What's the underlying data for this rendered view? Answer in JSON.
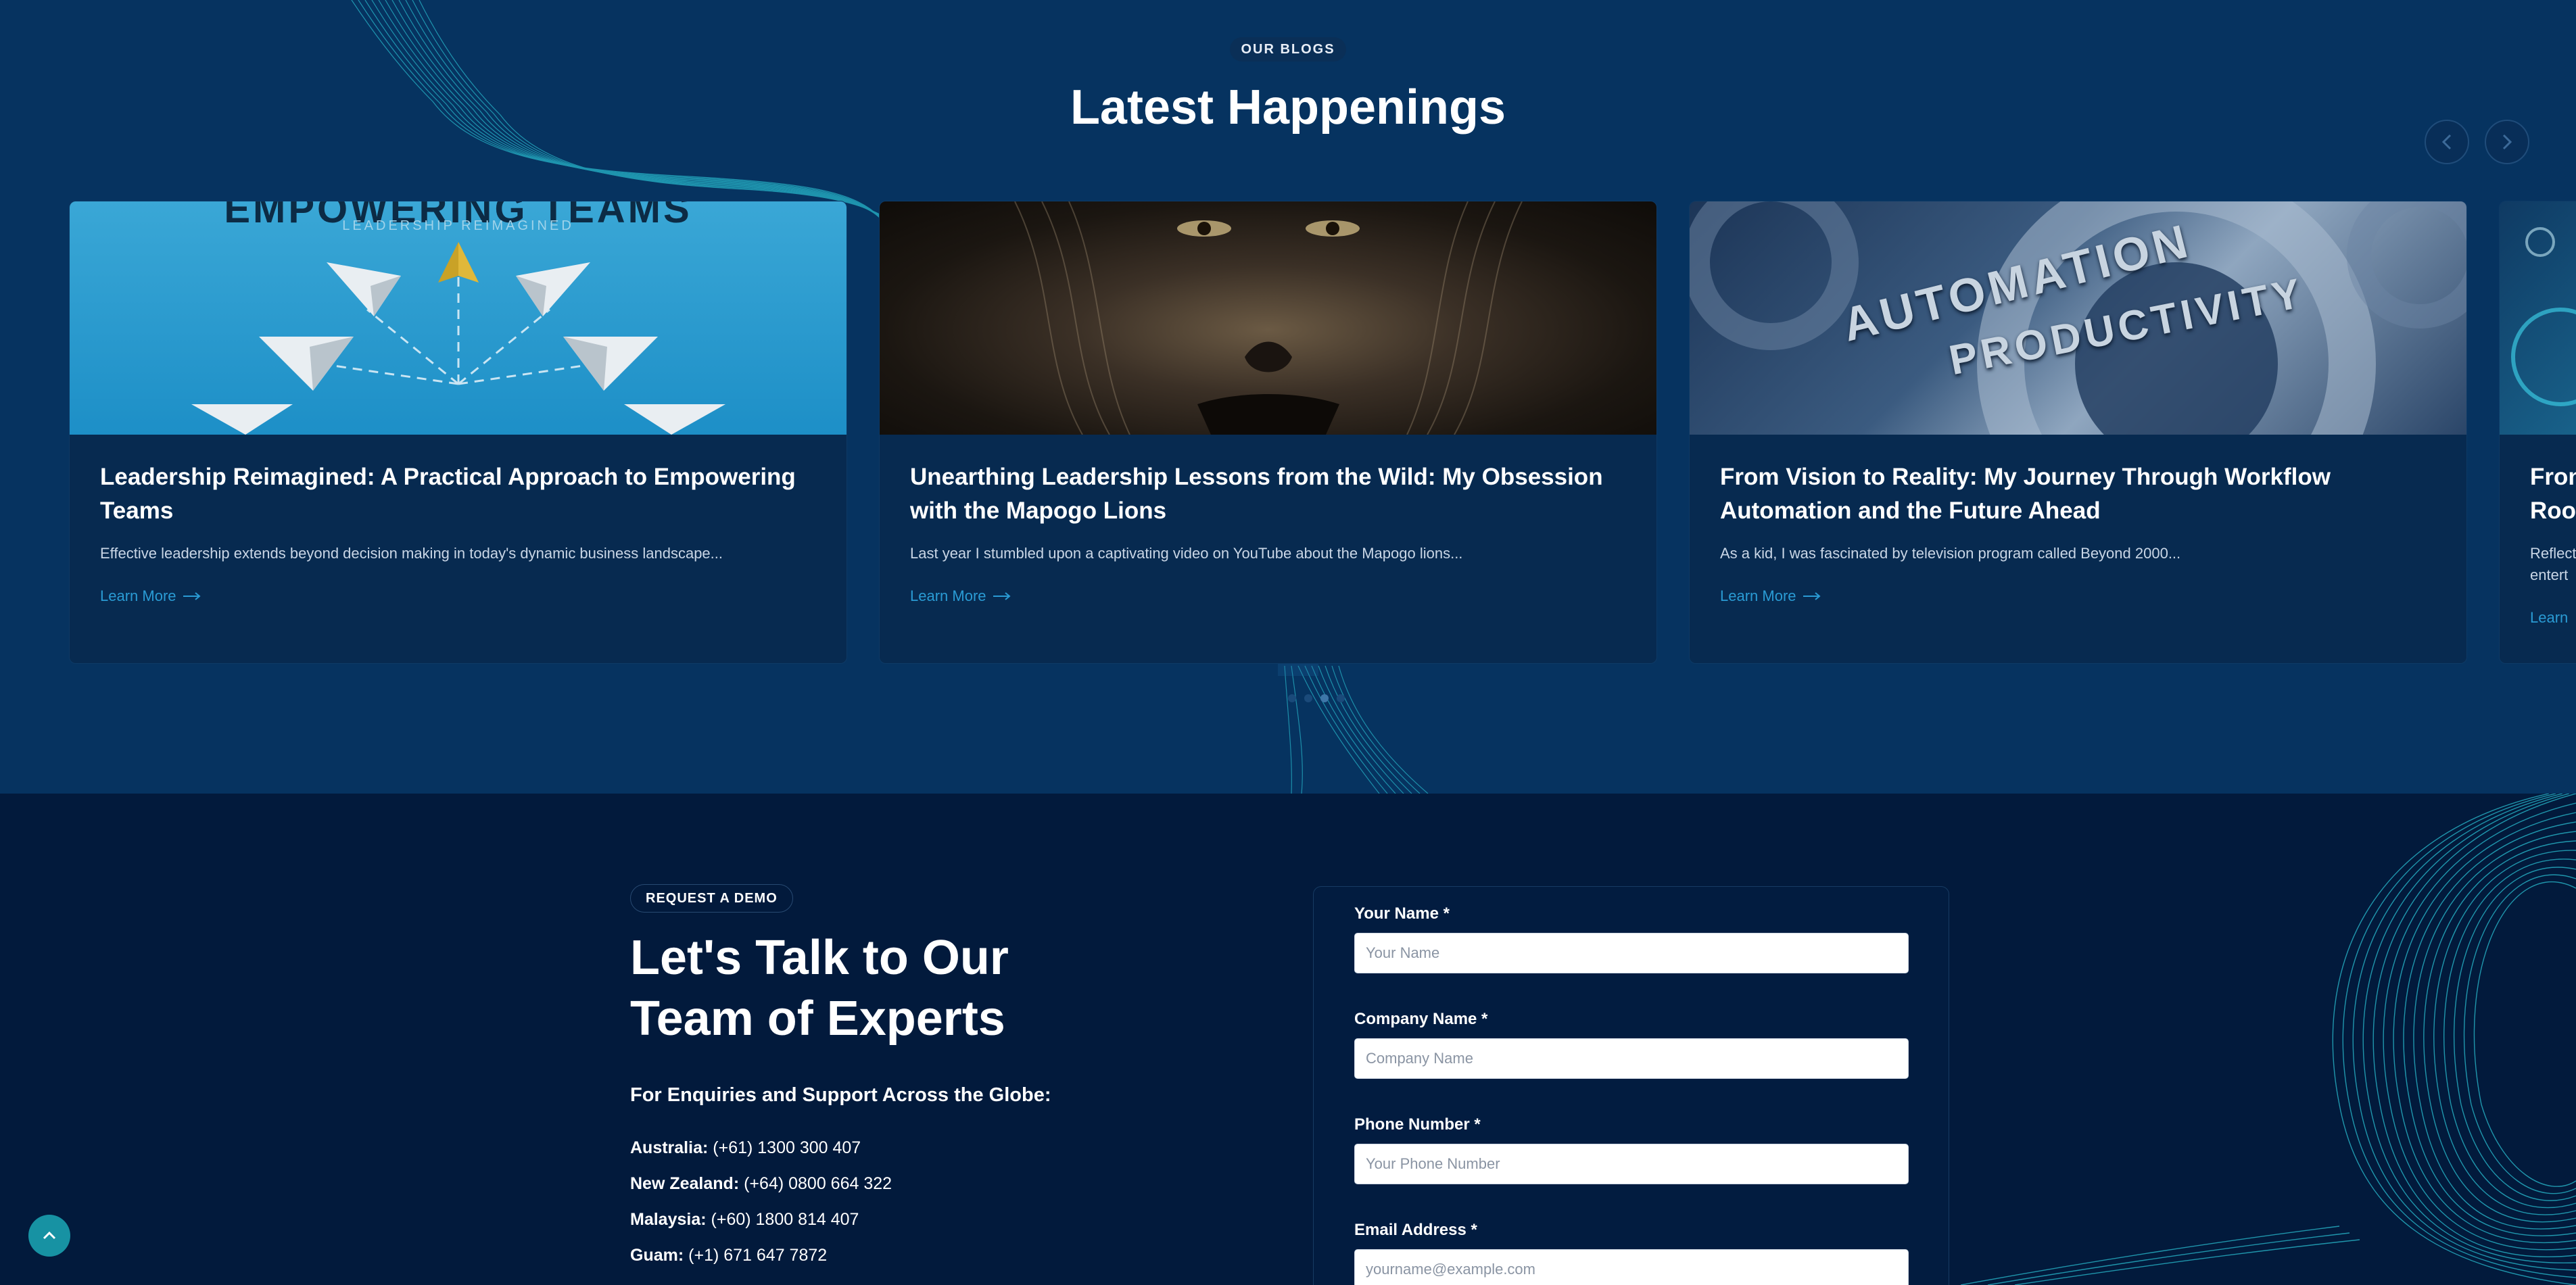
{
  "blogs": {
    "badge": "OUR BLOGS",
    "title": "Latest Happenings",
    "prev_icon": "chevron-left-icon",
    "next_icon": "chevron-right-icon",
    "cards": [
      {
        "image_text_top": "EMPOWERING TEAMS",
        "image_text_sub": "LEADERSHIP REIMAGINED",
        "title": "Leadership Reimagined: A Practical Approach to Empowering Teams",
        "excerpt": "Effective leadership extends beyond decision making in today's dynamic business landscape...",
        "link": "Learn More"
      },
      {
        "title": "Unearthing Leadership Lessons from the Wild: My Obsession with the Mapogo Lions",
        "excerpt": "Last year I stumbled upon a captivating video on YouTube about the Mapogo lions...",
        "link": "Learn More"
      },
      {
        "image_text_top": "AUTOMATION",
        "image_text_sub": "PRODUCTIVITY",
        "title": "From Vision to Reality: My Journey Through Workflow Automation and the Future Ahead",
        "excerpt": "As a kid, I was fascinated by television program called Beyond 2000...",
        "link": "Learn More"
      },
      {
        "title": "Fron Roon",
        "excerpt": "Reflect entert",
        "link": "Learn"
      }
    ],
    "dots_active_index": 2
  },
  "contact": {
    "badge": "REQUEST A DEMO",
    "title": "Let's Talk to Our Team of Experts",
    "enquiries": "For Enquiries and Support Across the Globe:",
    "offices": [
      {
        "country": "Australia:",
        "phone": "(+61) 1300 300 407"
      },
      {
        "country": "New Zealand:",
        "phone": "(+64) 0800 664 322"
      },
      {
        "country": "Malaysia:",
        "phone": "(+60) 1800 814 407"
      },
      {
        "country": "Guam:",
        "phone": "(+1) 671 647 7872"
      }
    ],
    "form": {
      "fields": [
        {
          "label": "Your Name *",
          "placeholder": "Your Name"
        },
        {
          "label": "Company Name *",
          "placeholder": "Company Name"
        },
        {
          "label": "Phone Number *",
          "placeholder": "Your Phone Number"
        },
        {
          "label": "Email Address *",
          "placeholder": "yourname@example.com"
        }
      ]
    }
  },
  "colors": {
    "blog_bg": "#063360",
    "contact_bg": "#021a3c",
    "card_bg": "#072a50",
    "link": "#2a9bd4",
    "accent_teal": "#1792a3"
  },
  "scroll_top_icon": "chevron-up-icon"
}
